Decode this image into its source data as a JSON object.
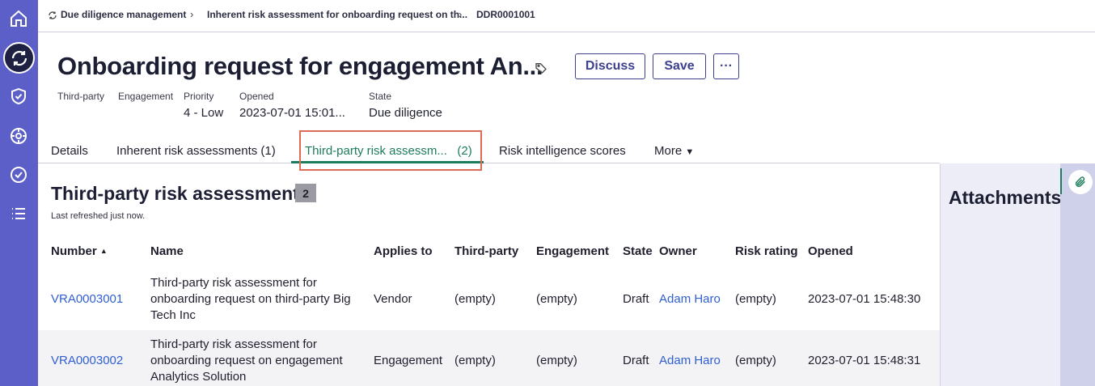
{
  "breadcrumb": {
    "items": [
      "Due diligence management",
      "Inherent risk assessment for onboarding request on th...",
      "DDR0001001"
    ]
  },
  "header": {
    "title": "Onboarding request for engagement An...",
    "discuss_label": "Discuss",
    "save_label": "Save",
    "more_label": "···",
    "meta": {
      "third_party_label": "Third-party",
      "engagement_label": "Engagement",
      "priority_label": "Priority",
      "priority_value": "4 - Low",
      "opened_label": "Opened",
      "opened_value": "2023-07-01 15:01...",
      "state_label": "State",
      "state_value": "Due diligence"
    }
  },
  "tabs": {
    "details": "Details",
    "inherent": "Inherent risk assessments (1)",
    "third_party": "Third-party risk assessm...",
    "third_party_count": "(2)",
    "risk_intel": "Risk intelligence scores",
    "more": "More"
  },
  "section": {
    "title": "Third-party risk assessments",
    "count": "2",
    "refreshed": "Last refreshed just now."
  },
  "table": {
    "headers": {
      "number": "Number",
      "name": "Name",
      "applies_to": "Applies to",
      "third_party": "Third-party",
      "engagement": "Engagement",
      "state": "State",
      "owner": "Owner",
      "risk_rating": "Risk rating",
      "opened": "Opened"
    },
    "rows": [
      {
        "number": "VRA0003001",
        "name": "Third-party risk assessment for onboarding request on third-party Big Tech Inc",
        "applies_to": "Vendor",
        "third_party": "(empty)",
        "engagement": "(empty)",
        "state": "Draft",
        "owner": "Adam Haro",
        "risk_rating": "(empty)",
        "opened": "2023-07-01 15:48:30"
      },
      {
        "number": "VRA0003002",
        "name": "Third-party risk assessment for onboarding request on engagement Analytics Solution",
        "applies_to": "Engagement",
        "third_party": "(empty)",
        "engagement": "(empty)",
        "state": "Draft",
        "owner": "Adam Haro",
        "risk_rating": "(empty)",
        "opened": "2023-07-01 15:48:31"
      }
    ]
  },
  "attachments": {
    "title": "Attachments"
  },
  "icons": {
    "rail": [
      "home-icon",
      "refresh-icon",
      "shield-check-icon",
      "gear-group-icon",
      "check-circle-icon",
      "list-icon"
    ],
    "tag": "tag-icon",
    "paperclip": "paperclip-icon"
  },
  "colors": {
    "rail": "#5b5fc7",
    "accent_green": "#1b7c5e",
    "link_blue": "#2f5fd0",
    "button_border": "#3d3f8f",
    "highlight": "#e06b55"
  }
}
